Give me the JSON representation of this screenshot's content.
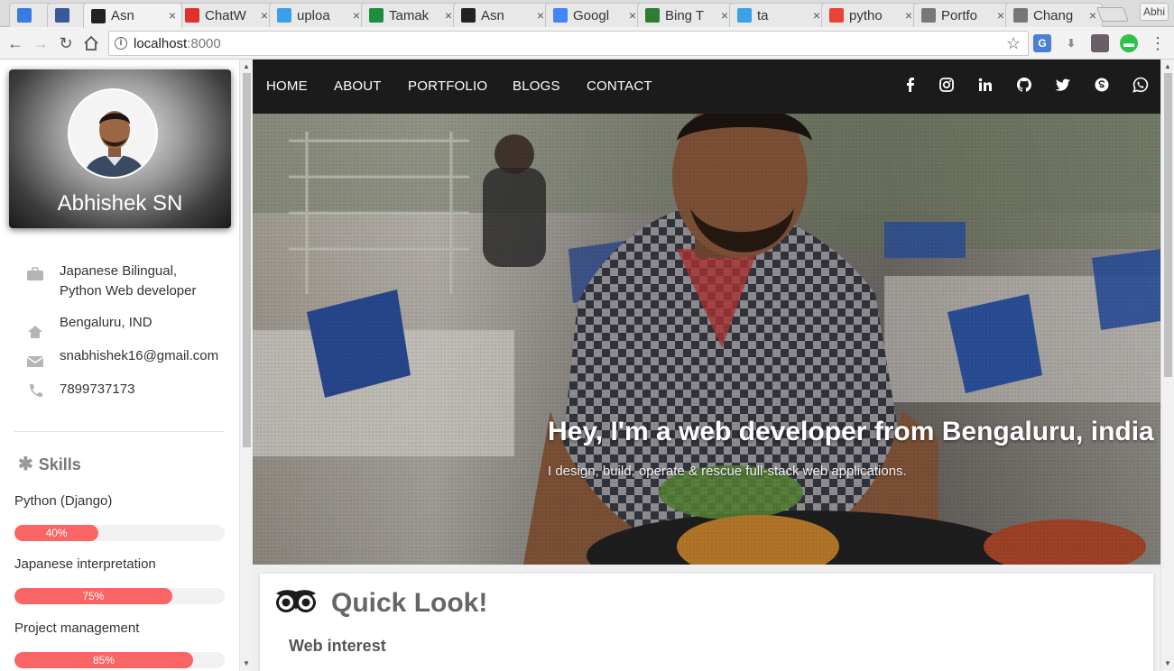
{
  "browser": {
    "tabs": [
      {
        "icon": "phone-icon",
        "title": "",
        "color": "#3b7ae0"
      },
      {
        "icon": "facebook-icon",
        "title": "",
        "color": "#3b5998"
      },
      {
        "icon": "amazon-icon",
        "title": "Asn",
        "color": "#222222",
        "active": true
      },
      {
        "icon": "chatwork-icon",
        "title": "ChatW",
        "color": "#e2302f"
      },
      {
        "icon": "m-icon",
        "title": "uploa",
        "color": "#3aa0e8"
      },
      {
        "icon": "sheets-icon",
        "title": "Tamak",
        "color": "#1e8e3e"
      },
      {
        "icon": "amazon-icon",
        "title": "Asn",
        "color": "#222222"
      },
      {
        "icon": "translate-icon",
        "title": "Googl",
        "color": "#4285f4"
      },
      {
        "icon": "bing-translate-icon",
        "title": "Bing T",
        "color": "#2e7d32"
      },
      {
        "icon": "m-icon",
        "title": "ta",
        "color": "#3aa0e8"
      },
      {
        "icon": "google-icon",
        "title": "pytho",
        "color": "#ea4335"
      },
      {
        "icon": "page-icon",
        "title": "Portfo",
        "color": "#777777"
      },
      {
        "icon": "page-icon",
        "title": "Chang",
        "color": "#777777"
      }
    ],
    "profile_chip": "Abhi",
    "url_host": "localhost",
    "url_port": ":8000"
  },
  "profile": {
    "name": "Abhishek SN",
    "job_line1": "Japanese Bilingual,",
    "job_line2": "Python Web developer",
    "location": "Bengaluru, IND",
    "email": "snabhishek16@gmail.com",
    "phone": "7899737173"
  },
  "skills": {
    "title": "Skills",
    "items": [
      {
        "label": "Python (Django)",
        "percent": 40,
        "percent_text": "40%"
      },
      {
        "label": "Japanese interpretation",
        "percent": 75,
        "percent_text": "75%"
      },
      {
        "label": "Project management",
        "percent": 85,
        "percent_text": "85%"
      }
    ]
  },
  "nav": {
    "home": "HOME",
    "about": "ABOUT",
    "portfolio": "PORTFOLIO",
    "blogs": "BLOGS",
    "contact": "CONTACT"
  },
  "hero": {
    "title": "Hey, I'm a web developer from Bengaluru, india",
    "subtitle": "I design, build, operate & rescue full-stack web applications."
  },
  "quick_look": {
    "title": "Quick Look!",
    "subtitle": "Web interest"
  },
  "colors": {
    "accent": "#f96464",
    "navbar": "#1b1b1b"
  }
}
